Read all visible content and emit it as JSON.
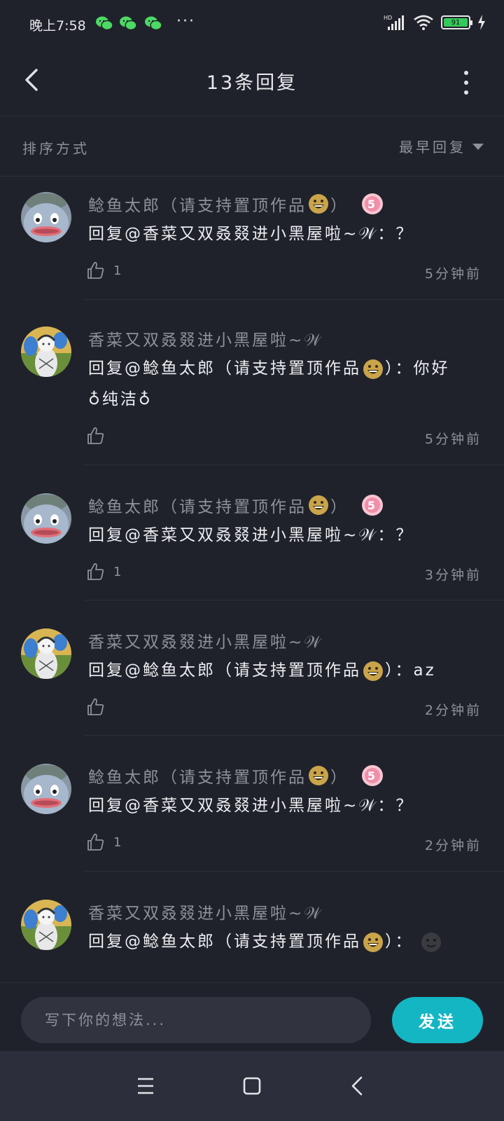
{
  "status_bar": {
    "time": "晚上7:58",
    "dots": "···",
    "network": "HD",
    "battery": "91"
  },
  "header": {
    "title": "13条回复"
  },
  "sort": {
    "label": "排序方式",
    "value": "最早回复"
  },
  "comments": [
    {
      "user": "鲶鱼太郎（请支持置顶作品",
      "user_suffix": "）",
      "badge": "5",
      "prefix": "回复",
      "text": "@香菜又双叒叕进小黑屋啦~𝒲：？",
      "text_line2": "",
      "likes": "1",
      "time": "5分钟前"
    },
    {
      "user": "香菜又双叒叕进小黑屋啦~𝒲",
      "prefix": "回复",
      "text": "@鲶鱼太郎（请支持置顶作品",
      "text_after_emoji": "）：你好",
      "text_line2": "♁纯洁♁",
      "likes": "",
      "time": "5分钟前"
    },
    {
      "user": "鲶鱼太郎（请支持置顶作品",
      "user_suffix": "）",
      "badge": "5",
      "prefix": "回复",
      "text": "@香菜又双叒叕进小黑屋啦~𝒲：？",
      "likes": "1",
      "time": "3分钟前"
    },
    {
      "user": "香菜又双叒叕进小黑屋啦~𝒲",
      "prefix": "回复",
      "text": "@鲶鱼太郎（请支持置顶作品",
      "text_after_emoji": "）：az",
      "likes": "",
      "time": "2分钟前"
    },
    {
      "user": "鲶鱼太郎（请支持置顶作品",
      "user_suffix": "）",
      "badge": "5",
      "prefix": "回复",
      "text": "@香菜又双叒叕进小黑屋啦~𝒲：？",
      "likes": "1",
      "time": "2分钟前"
    },
    {
      "user": "香菜又双叒叕进小黑屋啦~𝒲",
      "prefix": "回复",
      "text": "@鲶鱼太郎（请支持置顶作品",
      "text_after_emoji": "）：",
      "likes": "",
      "time": ""
    }
  ],
  "input": {
    "placeholder": "写下你的想法...",
    "send_label": "发送"
  },
  "icons": {
    "back": "chevron-left-icon",
    "more": "more-vertical-icon",
    "sort": "caret-down-icon",
    "like": "thumbs-up-icon",
    "nav_menu": "menu-icon",
    "nav_home": "square-icon",
    "nav_back": "back-icon"
  },
  "colors": {
    "background": "#20222b",
    "accent": "#14b6c4",
    "muted_text": "#8e919a",
    "badge": "#f29bb5"
  }
}
